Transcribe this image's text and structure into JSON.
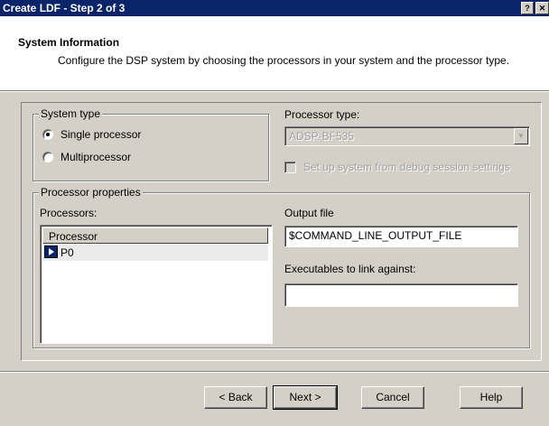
{
  "window": {
    "title": "Create LDF - Step 2 of 3",
    "help_button": "?",
    "close_button": "✕"
  },
  "header": {
    "title": "System Information",
    "subtitle": "Configure the DSP system by choosing the processors in your system and the processor type."
  },
  "system_type": {
    "legend": "System type",
    "options": [
      {
        "label": "Single processor",
        "selected": true
      },
      {
        "label": "Multiprocessor",
        "selected": false
      }
    ]
  },
  "processor_type": {
    "label": "Processor type:",
    "value": "ADSP-BF535",
    "enabled": false,
    "dropdown_icon": "chevron-down-icon",
    "debug_checkbox": {
      "label": "Set up system from debug session settings",
      "checked": false,
      "enabled": false
    }
  },
  "processor_properties": {
    "legend": "Processor properties",
    "processors_label": "Processors:",
    "column_header": "Processor",
    "rows": [
      {
        "name": "P0",
        "icon": "processor-icon"
      }
    ],
    "output_file_label": "Output file",
    "output_file_value": "$COMMAND_LINE_OUTPUT_FILE",
    "executables_label": "Executables to link against:",
    "executables_value": ""
  },
  "buttons": {
    "back": "< Back",
    "next": "Next >",
    "cancel": "Cancel",
    "help": "Help"
  },
  "colors": {
    "titlebar": "#0a246a",
    "face": "#d4d0c8",
    "header_bg": "#ffffff"
  }
}
